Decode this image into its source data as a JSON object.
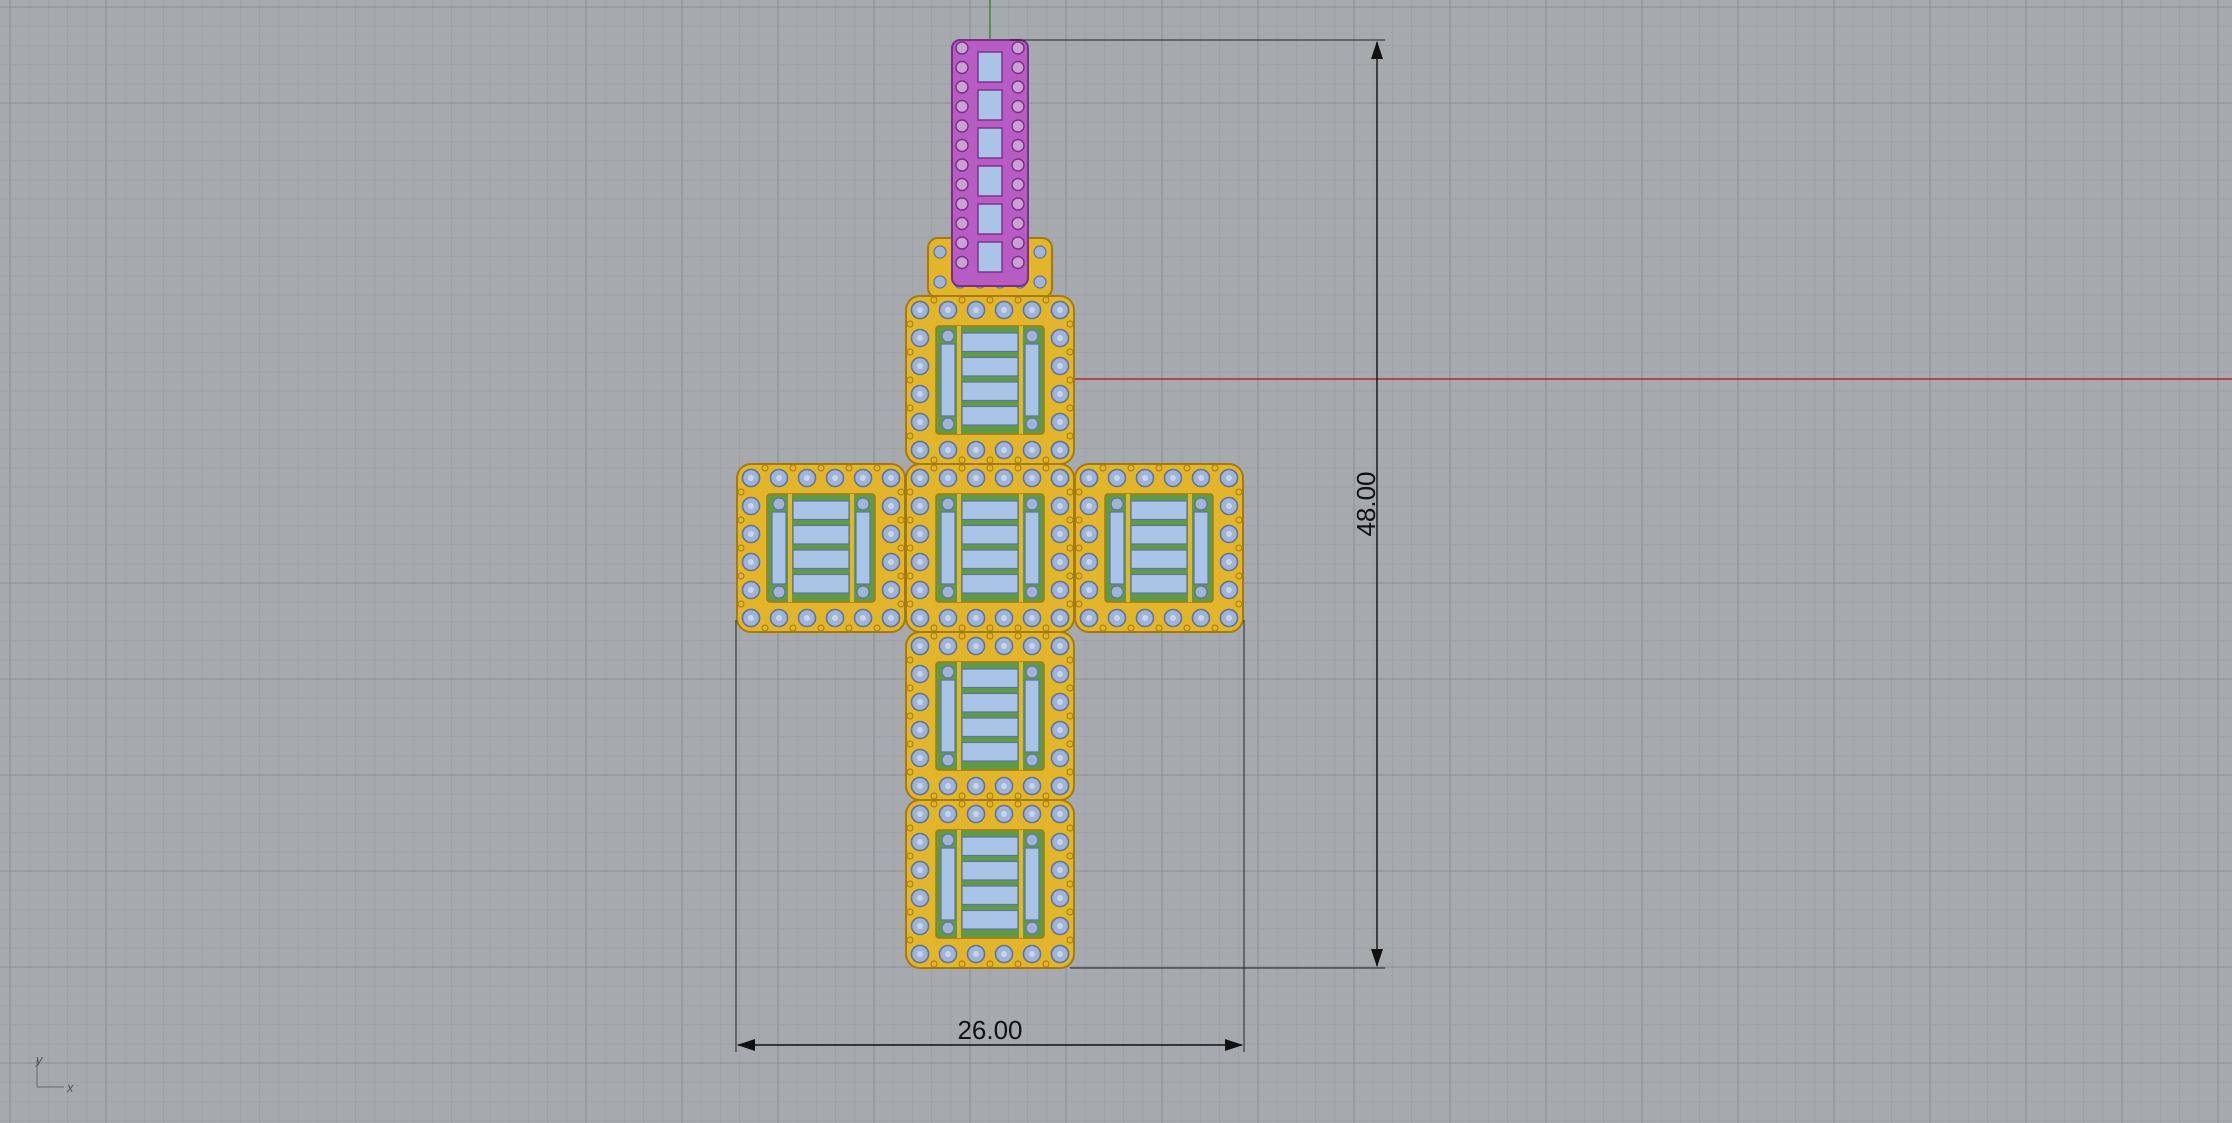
{
  "viewport": {
    "background": "#a6aaae",
    "grid_color_minor": "#9da1a5",
    "grid_color_major": "#8f9397",
    "x_axis_color": "#b0262e",
    "y_axis_color": "#2f8f3a"
  },
  "dimensions": {
    "height_label": "48.00",
    "width_label": "26.00"
  },
  "model": {
    "metal_color": "#e2b52a",
    "metal_dark": "#a57a10",
    "stone_color": "#9fb4d8",
    "stone_dark": "#5e7498",
    "baguette_color": "#a9c4e6",
    "prong_green": "#5f9a4a",
    "bail_color": "#b65cc2",
    "bail_dark": "#7a2e86"
  },
  "axis_icon": {
    "y_label": "y",
    "x_label": "x"
  }
}
